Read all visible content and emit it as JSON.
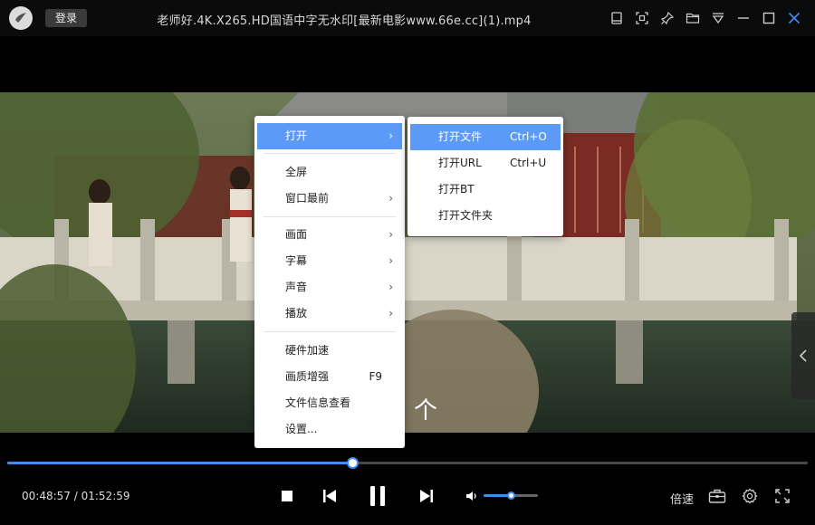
{
  "titlebar": {
    "login_label": "登录",
    "title": "老师好.4K.X265.HD国语中字无水印[最新电影www.66e.cc](1).mp4",
    "icons": [
      "mini-mode-icon",
      "screenshot-icon",
      "pin-icon",
      "folder-icon",
      "menu-icon",
      "minimize-icon",
      "maximize-icon",
      "close-icon"
    ]
  },
  "menu": {
    "items": [
      {
        "label": "打开",
        "has_submenu": true,
        "active": true
      },
      {
        "label": "全屏"
      },
      {
        "label": "窗口最前",
        "has_submenu": true
      },
      {
        "label": "画面",
        "has_submenu": true
      },
      {
        "label": "字幕",
        "has_submenu": true
      },
      {
        "label": "声音",
        "has_submenu": true
      },
      {
        "label": "播放",
        "has_submenu": true
      },
      {
        "label": "硬件加速"
      },
      {
        "label": "画质增强",
        "shortcut": "F9"
      },
      {
        "label": "文件信息查看"
      },
      {
        "label": "设置..."
      }
    ]
  },
  "submenu": {
    "items": [
      {
        "label": "打开文件",
        "shortcut": "Ctrl+O",
        "active": true
      },
      {
        "label": "打开URL",
        "shortcut": "Ctrl+U"
      },
      {
        "label": "打开BT"
      },
      {
        "label": "打开文件夹"
      }
    ]
  },
  "overlay": {
    "cursor_glyph": "个"
  },
  "player": {
    "current_time": "00:48:57",
    "separator": "/",
    "total_time": "01:52:59",
    "progress_fraction": 0.431,
    "volume_fraction": 0.5,
    "speed_label": "倍速"
  },
  "colors": {
    "accent": "#3d8ef0",
    "menu_highlight": "#5b9bf7"
  }
}
